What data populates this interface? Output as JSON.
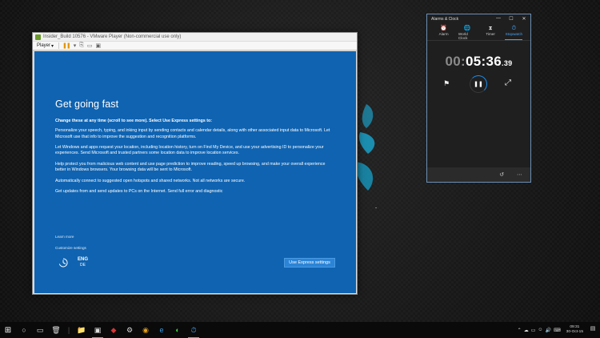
{
  "vmware": {
    "title": "Insider_Build 10576 - VMware Player (Non-commercial use only)",
    "player_menu": "Player",
    "player_dropdown": "▾"
  },
  "oobe": {
    "heading": "Get going fast",
    "lead": "Change these at any time (scroll to see more). Select Use Express settings to:",
    "paragraphs": [
      "Personalize your speech, typing, and inking input by sending contacts and calendar details, along with other associated input data to Microsoft. Let Microsoft use that info to improve the suggestion and recognition platforms.",
      "Let Windows and apps request your location, including location history, turn on Find My Device, and use your advertising ID to personalize your experiences. Send Microsoft and trusted partners some location data to improve location services.",
      "Help protect you from malicious web content and use page prediction to improve reading, speed up browsing, and make your overall experience better in Windows browsers. Your browsing data will be sent to Microsoft.",
      "Automatically connect to suggested open hotspots and shared networks. Not all networks are secure.",
      "Get updates from and send updates to PCs on the Internet. Send full error and diagnostic"
    ],
    "learn_more": "Learn more",
    "customize": "Customize settings",
    "lang_primary": "ENG",
    "lang_secondary": "DE",
    "express_button": "Use Express settings"
  },
  "clock_app": {
    "title": "Alarms & Clock",
    "tabs": [
      {
        "label": "Alarm",
        "icon": "⏰"
      },
      {
        "label": "World Clock",
        "icon": "🌐"
      },
      {
        "label": "Timer",
        "icon": "⧗"
      },
      {
        "label": "Stopwatch",
        "icon": "⏱"
      }
    ],
    "active_tab": "Stopwatch",
    "time_hours": "00:",
    "time_main": "05:36",
    "time_ms": ".39",
    "win_minimize": "—",
    "win_maximize": "☐",
    "win_close": "✕"
  },
  "taskbar": {
    "time": "09:31",
    "date": "30-Oct-15"
  },
  "colors": {
    "oobe_blue": "#0f63b1",
    "accent": "#1d8ff0"
  }
}
